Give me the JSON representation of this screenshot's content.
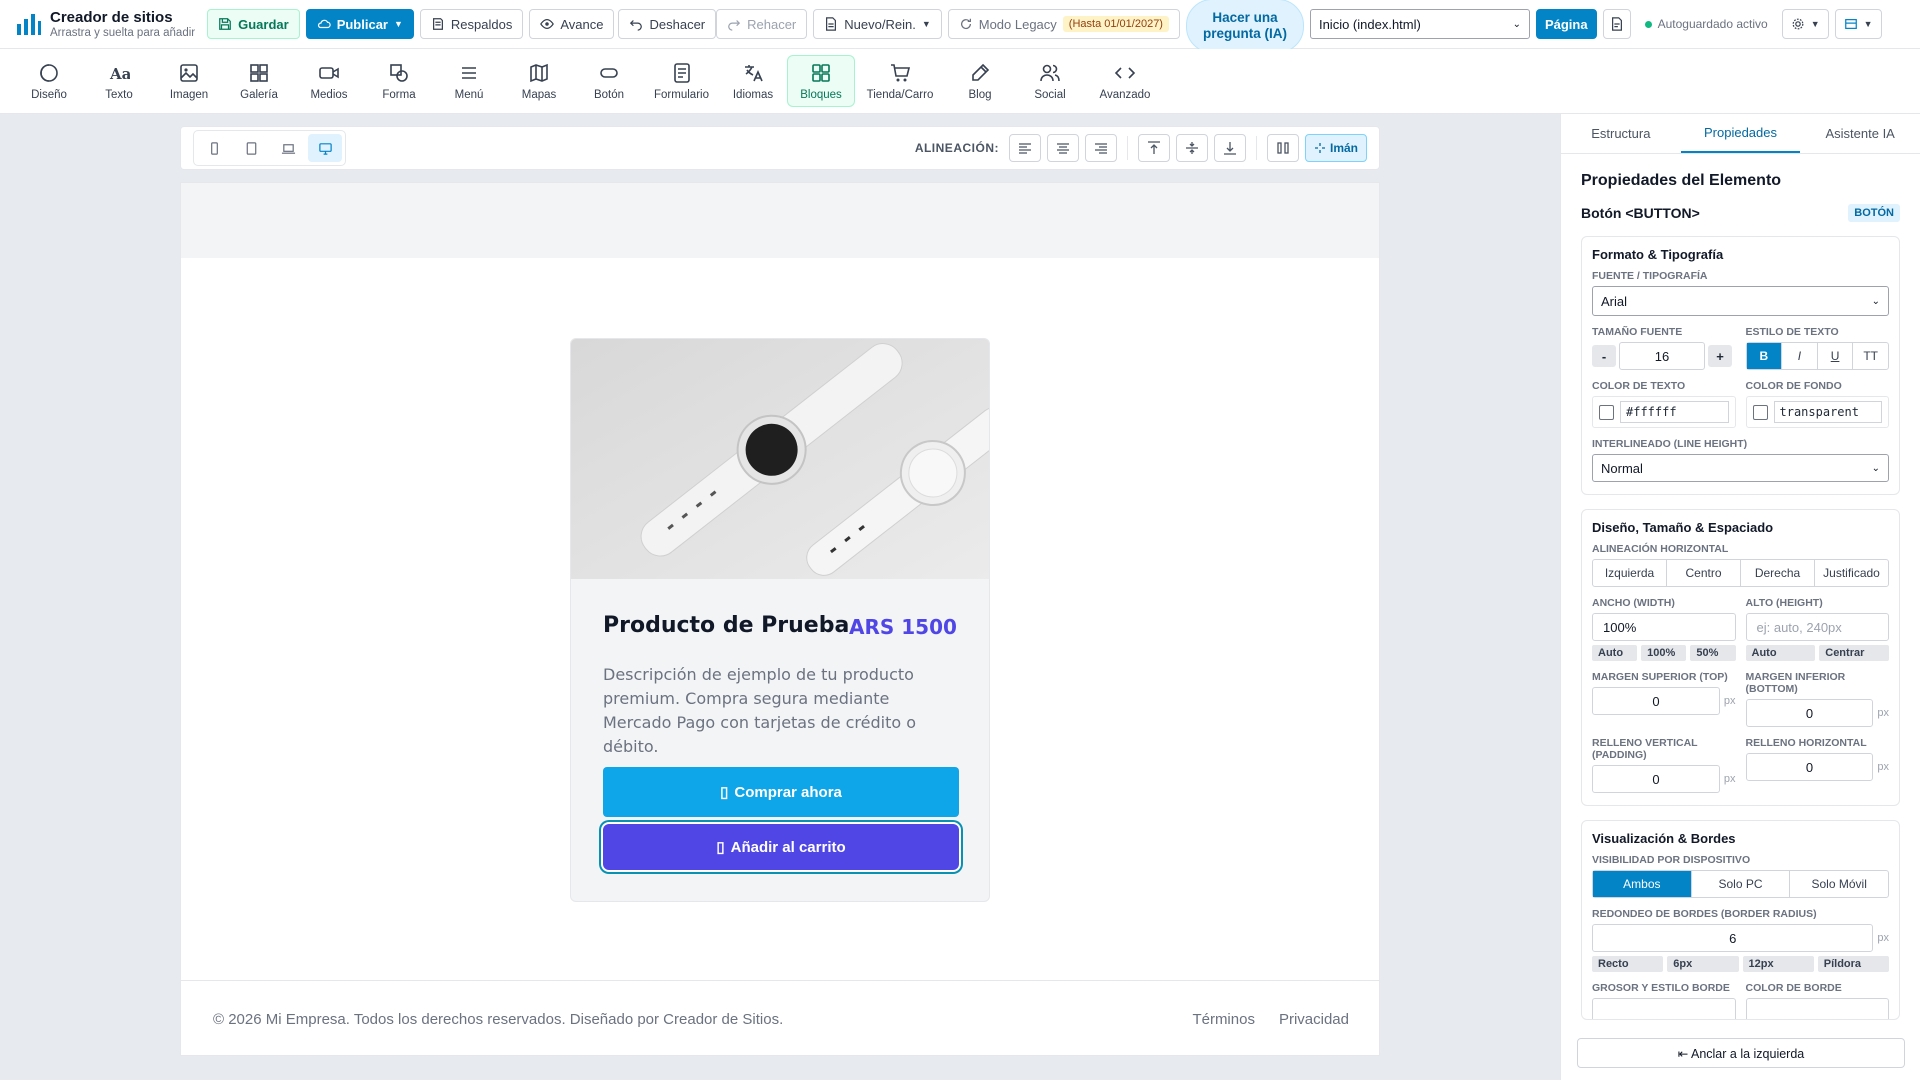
{
  "app": {
    "title": "Creador de sitios",
    "subtitle": "Arrastra y suelta para añadir"
  },
  "topbar": {
    "save": "Guardar",
    "publish": "Publicar",
    "backups": "Respaldos",
    "preview": "Avance",
    "undo": "Deshacer",
    "redo": "Rehacer",
    "new_reset": "Nuevo/Rein.",
    "legacy": "Modo Legacy",
    "legacy_badge": "(Hasta 01/01/2027)",
    "ask_ai": "Hacer una pregunta (IA)",
    "page_select": "Inicio (index.html)",
    "page_btn": "Página",
    "autosave": "Autoguardado activo"
  },
  "toolbar": {
    "items": [
      "Diseño",
      "Texto",
      "Imagen",
      "Galería",
      "Medios",
      "Forma",
      "Menú",
      "Mapas",
      "Botón",
      "Formulario",
      "Idiomas",
      "Bloques",
      "Tienda/Carro",
      "Blog",
      "Social",
      "Avanzado"
    ],
    "active": "Bloques"
  },
  "device_bar": {
    "align_label": "ALINEACIÓN:",
    "magnet": "Imán"
  },
  "product": {
    "title": "Producto de Prueba",
    "price": "ARS 1500",
    "description": "Descripción de ejemplo de tu producto premium. Compra segura mediante Mercado Pago con tarjetas de crédito o débito.",
    "buy_button": "Comprar ahora",
    "cart_button": "Añadir al carrito"
  },
  "footer": {
    "copyright": "© 2026 Mi Empresa. Todos los derechos reservados. Diseñado por Creador de Sitios.",
    "links": [
      "Términos",
      "Privacidad"
    ]
  },
  "panel": {
    "tabs": [
      "Estructura",
      "Propiedades",
      "Asistente IA"
    ],
    "active_tab": "Propiedades",
    "title": "Propiedades del Elemento",
    "element_name": "Botón <BUTTON>",
    "element_tag": "BOTÓN",
    "format": {
      "heading": "Formato & Tipografía",
      "font_label": "FUENTE / TIPOGRAFÍA",
      "font_value": "Arial",
      "size_label": "TAMAÑO FUENTE",
      "size_value": "16",
      "style_label": "ESTILO DE TEXTO",
      "style_buttons": [
        "B",
        "I",
        "U",
        "TT"
      ],
      "text_color_label": "COLOR DE TEXTO",
      "text_color_value": "#ffffff",
      "bg_color_label": "COLOR DE FONDO",
      "bg_color_value": "transparent",
      "line_height_label": "INTERLINEADO (LINE HEIGHT)",
      "line_height_value": "Normal"
    },
    "layout": {
      "heading": "Diseño, Tamaño & Espaciado",
      "align_label": "ALINEACIÓN HORIZONTAL",
      "align_options": [
        "Izquierda",
        "Centro",
        "Derecha",
        "Justificado"
      ],
      "width_label": "ANCHO (WIDTH)",
      "width_value": "100%",
      "width_presets": [
        "Auto",
        "100%",
        "50%"
      ],
      "height_label": "ALTO (HEIGHT)",
      "height_placeholder": "ej: auto, 240px",
      "height_presets": [
        "Auto",
        "Centrar"
      ],
      "margin_top_label": "MARGEN SUPERIOR (TOP)",
      "margin_top_value": "0",
      "margin_bottom_label": "MARGEN INFERIOR (BOTTOM)",
      "margin_bottom_value": "0",
      "pad_v_label": "RELLENO VERTICAL (PADDING)",
      "pad_v_value": "0",
      "pad_h_label": "RELLENO HORIZONTAL",
      "pad_h_value": "0",
      "unit": "px"
    },
    "visual": {
      "heading": "Visualización & Bordes",
      "visibility_label": "VISIBILIDAD POR DISPOSITIVO",
      "visibility_options": [
        "Ambos",
        "Solo PC",
        "Solo Móvil"
      ],
      "radius_label": "REDONDEO DE BORDES (BORDER RADIUS)",
      "radius_value": "6",
      "radius_presets": [
        "Recto",
        "6px",
        "12px",
        "Píldora"
      ],
      "border_label": "GROSOR Y ESTILO BORDE",
      "border_color_label": "COLOR DE BORDE"
    },
    "dock_button": "⇤ Anclar a la izquierda"
  },
  "colors": {
    "accent": "#0284c7",
    "price": "#4f46e5",
    "buy": "#0ea5e9",
    "cart": "#4f46e5",
    "active_tool": "#047857"
  }
}
